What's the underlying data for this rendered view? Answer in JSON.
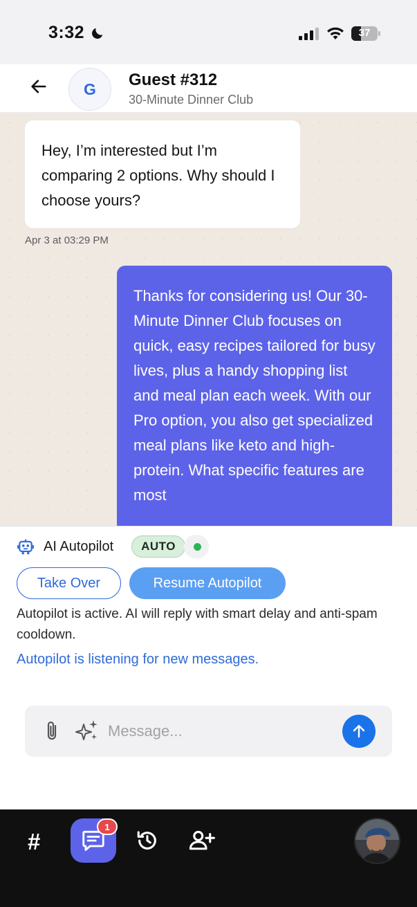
{
  "status_bar": {
    "time": "3:32",
    "battery_percent": "37",
    "battery_level": 0.37,
    "icons": [
      "moon-icon",
      "signal-icon",
      "wifi-icon",
      "battery-icon"
    ]
  },
  "header": {
    "avatar_initial": "G",
    "title": "Guest #312",
    "subtitle": "30-Minute Dinner Club",
    "back_icon": "arrow-left-icon"
  },
  "messages": [
    {
      "direction": "incoming",
      "text": "Hey, I’m interested but I’m comparing 2 options. Why should I choose yours?",
      "timestamp": "Apr 3 at 03:29 PM"
    },
    {
      "direction": "outgoing",
      "text": "Thanks for considering us! Our 30-Minute Dinner Club focuses on quick, easy recipes tailored for busy lives, plus a handy shopping list and meal plan each week. With our Pro option, you also get specialized meal plans like keto and high-protein. What specific features are most"
    }
  ],
  "autopilot": {
    "label": "AI Autopilot",
    "badge": "AUTO",
    "status_color": "#2fb455",
    "take_over_label": "Take Over",
    "resume_label": "Resume Autopilot",
    "description": "Autopilot is active. AI will reply with smart delay and anti-spam cooldown.",
    "listening_text": "Autopilot is listening for new messages."
  },
  "composer": {
    "placeholder": "Message...",
    "value": ""
  },
  "bottom_nav": {
    "hash_label": "#",
    "chat_badge": "1",
    "icons": [
      "hash-icon",
      "chat-icon",
      "history-icon",
      "add-user-icon",
      "profile-avatar"
    ]
  },
  "colors": {
    "accent": "#5d63e8",
    "link_blue": "#2f6bd8",
    "send_blue": "#1a73e8",
    "resume_blue": "#5b9ff2",
    "chat_background": "#efe9e1",
    "nav_background": "#101010",
    "badge_red": "#e5484d"
  }
}
